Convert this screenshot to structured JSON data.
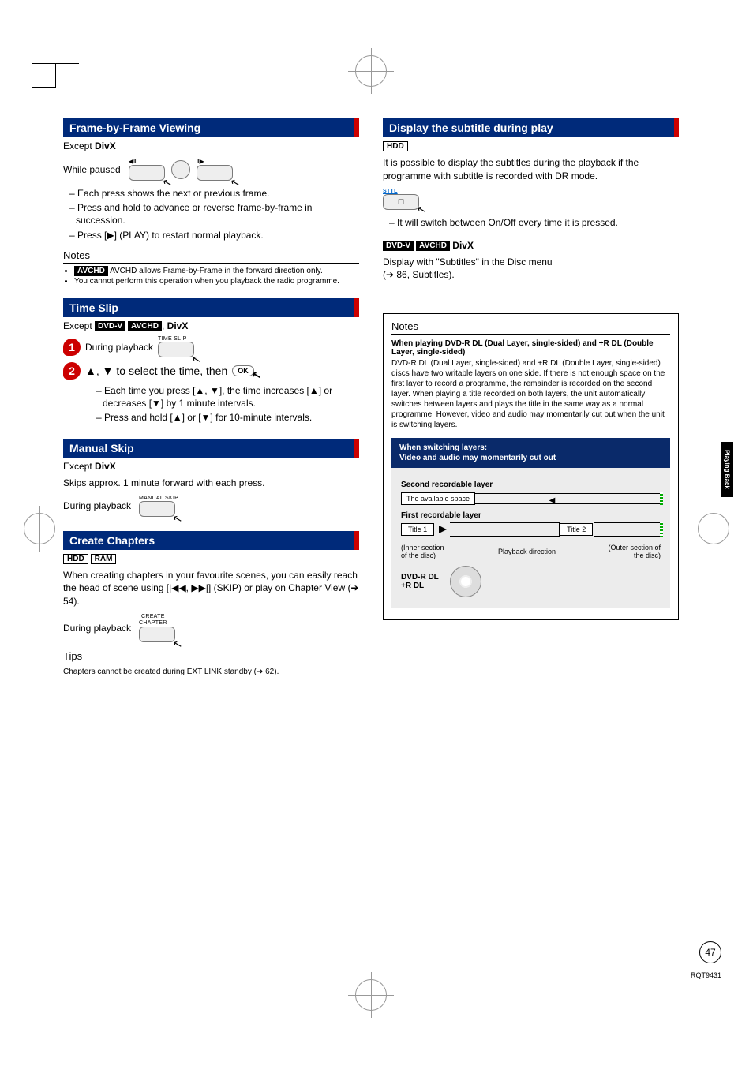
{
  "left": {
    "frame": {
      "bar": "Frame-by-Frame Viewing",
      "except": "Except",
      "except_tag": "DivX",
      "while_paused": "While paused",
      "lines": [
        "Each press shows the next or previous frame.",
        "Press and hold to advance or reverse frame-by-frame in succession.",
        "Press [▶] (PLAY) to restart normal playback."
      ],
      "notes_h": "Notes",
      "notes": [
        "AVCHD allows Frame-by-Frame in the forward direction only.",
        "You cannot perform this operation when you playback the radio programme."
      ],
      "notes_tag": "AVCHD"
    },
    "timeslip": {
      "bar": "Time Slip",
      "except": "Except",
      "tags": [
        "DVD-V",
        "AVCHD"
      ],
      "tag_sep": ",",
      "except_tag2": "DivX",
      "step1_label": "During playback",
      "btn1": "TIME SLIP",
      "step2_text": "▲, ▼ to select the time, then",
      "ok": "OK",
      "sub": [
        "Each time you press [▲, ▼], the time increases [▲] or decreases [▼] by 1 minute intervals.",
        "Press and hold [▲] or [▼] for 10-minute intervals."
      ]
    },
    "manualskip": {
      "bar": "Manual Skip",
      "except": "Except",
      "except_tag": "DivX",
      "desc": "Skips approx. 1 minute forward with each press.",
      "during": "During playback",
      "btn": "MANUAL SKIP"
    },
    "chapters": {
      "bar": "Create Chapters",
      "tags": [
        "HDD",
        "RAM"
      ],
      "desc": "When creating chapters in your favourite scenes, you can easily reach the head of scene using [|◀◀, ▶▶|] (SKIP) or play on Chapter View (➔ 54).",
      "during": "During playback",
      "btn": "CREATE CHAPTER",
      "tips_h": "Tips",
      "tips": "Chapters cannot be created during EXT LINK standby (➔ 62)."
    }
  },
  "right": {
    "subtitle": {
      "bar": "Display the subtitle during play",
      "tags": [
        "HDD"
      ],
      "desc": "It is possible to display the subtitles during the playback if the programme with subtitle is recorded with DR mode.",
      "btn": "STTL",
      "line": "It will switch between On/Off every time it is pressed.",
      "tags2": [
        "DVD-V",
        "AVCHD"
      ],
      "tag2_extra": "DivX",
      "desc2a": "Display with \"Subtitles\" in the Disc menu",
      "desc2b": "(➔ 86, Subtitles)."
    },
    "notesbox": {
      "h": "Notes",
      "title": "When playing DVD-R DL (Dual Layer, single-sided) and +R DL (Double Layer, single-sided)",
      "body": "DVD-R DL (Dual Layer, single-sided) and +R DL (Double Layer, single-sided) discs have two writable layers on one side. If there is not enough space on the first layer to record a programme, the remainder is recorded on the second layer. When playing a title recorded on both layers, the unit automatically switches between layers and plays the title in the same way as a normal programme. However, video and audio may momentarily cut out when the unit is switching layers.",
      "diag_head1": "When switching layers:",
      "diag_head2": "Video and audio may momentarily cut out",
      "second_layer": "Second recordable layer",
      "avail": "The available space",
      "first_layer": "First recordable layer",
      "title1": "Title 1",
      "title2": "Title 2",
      "inner": "(Inner section of the disc)",
      "outer": "(Outer section of the disc)",
      "playdir": "Playback direction",
      "disc_label": "DVD-R DL\n+R DL"
    }
  },
  "page": {
    "side_tab": "Playing Back",
    "num": "47",
    "code": "RQT9431"
  }
}
